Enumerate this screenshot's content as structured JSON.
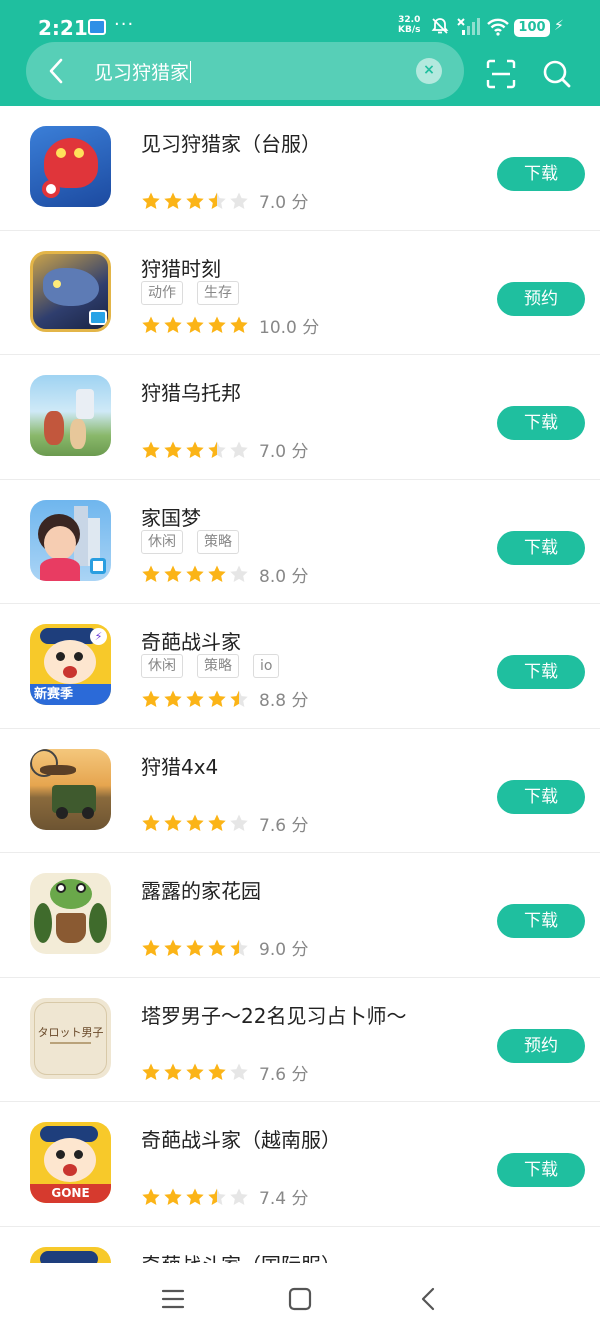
{
  "status_bar": {
    "time": "2:21",
    "dots": "···",
    "speed_value": "32.0",
    "speed_unit": "KB/s",
    "battery": "100"
  },
  "search": {
    "query": "见习狩猎家",
    "clear_symbol": "×"
  },
  "colors": {
    "brand": "#1fbf9f",
    "star_on": "#fbb417",
    "star_off": "#e6e6e6"
  },
  "apps": [
    {
      "name": "见习狩猎家（台服）",
      "tags": [],
      "stars": 3.5,
      "score": "7.0 分",
      "action": "下载"
    },
    {
      "name": "狩猎时刻",
      "tags": [
        "动作",
        "生存"
      ],
      "stars": 5,
      "score": "10.0 分",
      "action": "预约"
    },
    {
      "name": "狩猎乌托邦",
      "tags": [],
      "stars": 3.5,
      "score": "7.0 分",
      "action": "下载"
    },
    {
      "name": "家国梦",
      "tags": [
        "休闲",
        "策略"
      ],
      "stars": 4,
      "score": "8.0 分",
      "action": "下载"
    },
    {
      "name": "奇葩战斗家",
      "tags": [
        "休闲",
        "策略",
        "io"
      ],
      "stars": 4.5,
      "score": "8.8 分",
      "action": "下载"
    },
    {
      "name": "狩猎4x4",
      "tags": [],
      "stars": 4,
      "score": "7.6 分",
      "action": "下载"
    },
    {
      "name": "露露的家花园",
      "tags": [],
      "stars": 4.5,
      "score": "9.0 分",
      "action": "下载"
    },
    {
      "name": "塔罗男子～22名见习占卜师～",
      "tags": [],
      "stars": 4,
      "score": "7.6 分",
      "action": "预约"
    },
    {
      "name": "奇葩战斗家（越南服）",
      "tags": [],
      "stars": 3.5,
      "score": "7.4 分",
      "action": "下载"
    },
    {
      "name": "奇葩战斗家（国际服）",
      "tags": [],
      "stars": 0,
      "score": "",
      "action": ""
    }
  ],
  "icon_texts": {
    "qipa": "新赛季",
    "tarot": "タロット男子",
    "gone": "GONE"
  }
}
